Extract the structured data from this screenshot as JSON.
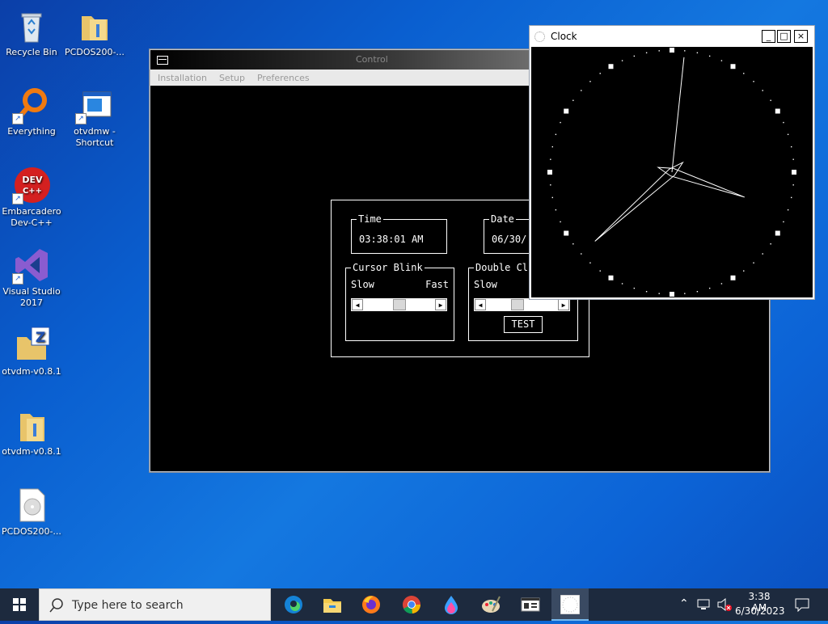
{
  "desktop": {
    "icons": [
      {
        "label": "Recycle Bin",
        "icon": "recycle-bin-icon"
      },
      {
        "label": "PCDOS200-...",
        "icon": "folder-icon"
      },
      {
        "label": "Everything",
        "icon": "everything-search-icon"
      },
      {
        "label": "otvdmw - Shortcut",
        "icon": "window-app-icon"
      },
      {
        "label": "Embarcadero Dev-C++",
        "icon": "devcpp-icon"
      },
      {
        "label": "Visual Studio 2017",
        "icon": "visual-studio-icon"
      },
      {
        "label": "otvdm-v0.8.1",
        "icon": "zip-folder-icon"
      },
      {
        "label": "otvdm-v0.8.1",
        "icon": "folder-icon"
      },
      {
        "label": "PCDOS200-...",
        "icon": "disc-image-icon"
      }
    ]
  },
  "control_window": {
    "title": "Control",
    "menu": [
      "Installation",
      "Setup",
      "Preferences"
    ],
    "time": {
      "label": "Time",
      "value": "03:38:01 AM"
    },
    "date": {
      "label": "Date",
      "value": "06/30/"
    },
    "cursor_blink": {
      "label": "Cursor Blink",
      "slow": "Slow",
      "fast": "Fast",
      "level": 0.5
    },
    "double_click": {
      "label": "Double Cl",
      "slow": "Slow",
      "test_button": "TEST",
      "level": 0.45
    }
  },
  "clock_window": {
    "title": "Clock",
    "minimize": "_",
    "maximize": "□",
    "close": "×",
    "time": {
      "hours": 3,
      "minutes": 38,
      "seconds": 1
    }
  },
  "taskbar": {
    "search_placeholder": "Type here to search",
    "apps": [
      "edge-icon",
      "file-explorer-icon",
      "firefox-icon",
      "chrome-icon",
      "paint3d-icon",
      "paint-icon",
      "control-panel-icon",
      "clock-app-icon"
    ],
    "clock_time": "3:38 AM",
    "clock_date": "6/30/2023"
  },
  "colors": {
    "desktop": "#0a5fd0",
    "taskbar": "#1d2a3e",
    "accent": "#0078d7"
  }
}
